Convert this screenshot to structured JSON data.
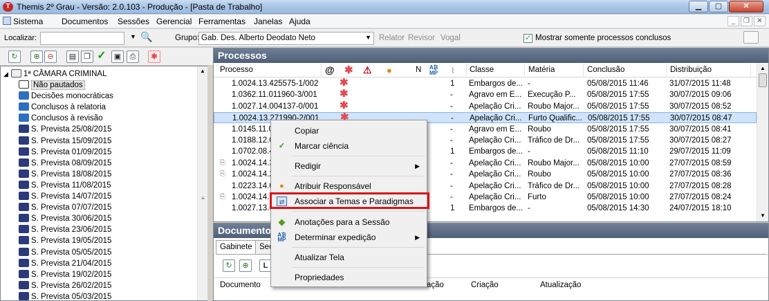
{
  "window": {
    "title": "Themis 2º Grau - Versão: 2.0.103 - Produção - [Pasta de Trabalho]",
    "app_icon": "T"
  },
  "menu": [
    "Sistema",
    "Documentos",
    "Sessões",
    "Gerencial",
    "Ferramentas",
    "Janelas",
    "Ajuda"
  ],
  "locbar": {
    "localizar_label": "Localizar:",
    "localizar_value": "",
    "grupo_label": "Grupo:",
    "grupo_value": "Gab. Des. Alberto Deodato Neto",
    "relator": "Relator",
    "revisor": "Revisor",
    "vogal": "Vogal",
    "mostrar_label": "Mostrar somente processos conclusos",
    "mostrar_checked": true
  },
  "tree": {
    "root": "1ª CÂMARA CRIMINAL",
    "items": [
      {
        "label": "Não pautados",
        "icon": "list-icon",
        "selected": true
      },
      {
        "label": "Decisões monocráticas",
        "icon": "users-icon"
      },
      {
        "label": "Conclusos à relatoria",
        "icon": "users-icon"
      },
      {
        "label": "Conclusos à revisão",
        "icon": "users-icon"
      },
      {
        "label": "S. Prevista 25/08/2015",
        "icon": "session-icon"
      },
      {
        "label": "S. Prevista 15/09/2015",
        "icon": "session-icon"
      },
      {
        "label": "S. Prevista 01/09/2015",
        "icon": "session-icon"
      },
      {
        "label": "S. Prevista 08/09/2015",
        "icon": "session-icon"
      },
      {
        "label": "S. Prevista 18/08/2015",
        "icon": "session-icon"
      },
      {
        "label": "S. Prevista 11/08/2015",
        "icon": "session-icon"
      },
      {
        "label": "S. Prevista 14/07/2015",
        "icon": "session-icon"
      },
      {
        "label": "S. Prevista 07/07/2015",
        "icon": "session-icon"
      },
      {
        "label": "S. Prevista 30/06/2015",
        "icon": "session-icon"
      },
      {
        "label": "S. Prevista 23/06/2015",
        "icon": "session-icon"
      },
      {
        "label": "S. Prevista 19/05/2015",
        "icon": "session-icon"
      },
      {
        "label": "S. Prevista 05/05/2015",
        "icon": "session-icon"
      },
      {
        "label": "S. Prevista 21/04/2015",
        "icon": "session-icon"
      },
      {
        "label": "S. Prevista 19/02/2015",
        "icon": "session-icon"
      },
      {
        "label": "S. Prevista 26/02/2015",
        "icon": "session-icon"
      },
      {
        "label": "S. Prevista 05/03/2015",
        "icon": "session-icon"
      }
    ]
  },
  "processos": {
    "title": "Processos",
    "columns": {
      "processo": "Processo",
      "n": "N",
      "classe": "Classe",
      "materia": "Matéria",
      "conclusao": "Conclusão",
      "distribuicao": "Distribuição"
    },
    "rows": [
      {
        "processo": "1.0024.13.425575-1/002",
        "n": "1",
        "classe": "Embargos de...",
        "materia": "-",
        "conclusao": "05/08/2015 11:46",
        "distribuicao": "31/07/2015 11:48"
      },
      {
        "processo": "1.0362.11.011960-3/001",
        "n": "-",
        "classe": "Agravo em E...",
        "materia": "Execução P...",
        "conclusao": "05/08/2015 17:55",
        "distribuicao": "30/07/2015 09:06"
      },
      {
        "processo": "1.0027.14.004137-0/001",
        "n": "-",
        "classe": "Apelação Cri...",
        "materia": "Roubo Major...",
        "conclusao": "05/08/2015 17:55",
        "distribuicao": "30/07/2015 08:52"
      },
      {
        "processo": "1.0024.13.271990-2/001",
        "n": "-",
        "classe": "Apelação Cri...",
        "materia": "Furto Qualific...",
        "conclusao": "05/08/2015 17:55",
        "distribuicao": "30/07/2015 08:47",
        "selected": true
      },
      {
        "processo": "1.0145.11.0",
        "n": "-",
        "classe": "Agravo em E...",
        "materia": "Roubo",
        "conclusao": "05/08/2015 17:55",
        "distribuicao": "30/07/2015 08:41"
      },
      {
        "processo": "1.0188.12.0",
        "n": "-",
        "classe": "Apelação Cri...",
        "materia": "Tráfico de Dr...",
        "conclusao": "05/08/2015 17:55",
        "distribuicao": "30/07/2015 08:27"
      },
      {
        "processo": "1.0702.08.4",
        "n": "1",
        "classe": "Embargos de...",
        "materia": "-",
        "conclusao": "05/08/2015 11:10",
        "distribuicao": "29/07/2015 11:09"
      },
      {
        "processo": "1.0024.14.3",
        "n": "-",
        "classe": "Apelação Cri...",
        "materia": "Roubo Major...",
        "conclusao": "05/08/2015 10:00",
        "distribuicao": "27/07/2015 08:59",
        "doc": true
      },
      {
        "processo": "1.0024.14.2",
        "n": "-",
        "classe": "Apelação Cri...",
        "materia": "Roubo",
        "conclusao": "05/08/2015 10:00",
        "distribuicao": "27/07/2015 08:36",
        "doc": true
      },
      {
        "processo": "1.0223.14.0",
        "n": "-",
        "classe": "Apelação Cri...",
        "materia": "Tráfico de Dr...",
        "conclusao": "05/08/2015 10:00",
        "distribuicao": "27/07/2015 08:28"
      },
      {
        "processo": "1.0024.14.1",
        "n": "-",
        "classe": "Apelação Cri...",
        "materia": "Furto",
        "conclusao": "05/08/2015 10:00",
        "distribuicao": "27/07/2015 08:24",
        "doc": true
      },
      {
        "processo": "1.0027.13.0",
        "n": "1",
        "classe": "Embargos de...",
        "materia": "-",
        "conclusao": "05/08/2015 14:30",
        "distribuicao": "24/07/2015 18:10"
      }
    ]
  },
  "documentos": {
    "title": "Documentos",
    "tabs": [
      "Gabinete",
      "Sec"
    ],
    "columns": {
      "documento": "Documento",
      "inicio": "Início",
      "processo": "Processo",
      "situacao": "Situação",
      "criacao": "Criação",
      "atualizacao": "Atualização"
    },
    "small_button": "L"
  },
  "context_menu": [
    {
      "label": "Copiar"
    },
    {
      "label": "Marcar ciência",
      "icon": "check-icon"
    },
    {
      "label": "Redigir",
      "submenu": true
    },
    {
      "label": "Atribuir Responsável",
      "icon": "person-icon"
    },
    {
      "label": "Associar a Temas e Paradigmas",
      "icon": "link-icon",
      "highlighted": true
    },
    {
      "label": "Anotações para a Sessão",
      "icon": "note-icon"
    },
    {
      "label": "Determinar expedição",
      "icon": "abc-icon",
      "submenu": true
    },
    {
      "label": "Atualizar Tela"
    },
    {
      "label": "Propriedades"
    }
  ],
  "colors": {
    "panel_header": "#5a6a83",
    "star": "#e04a52",
    "highlight": "#d9141d",
    "selected_row": "#cfe3fb"
  }
}
